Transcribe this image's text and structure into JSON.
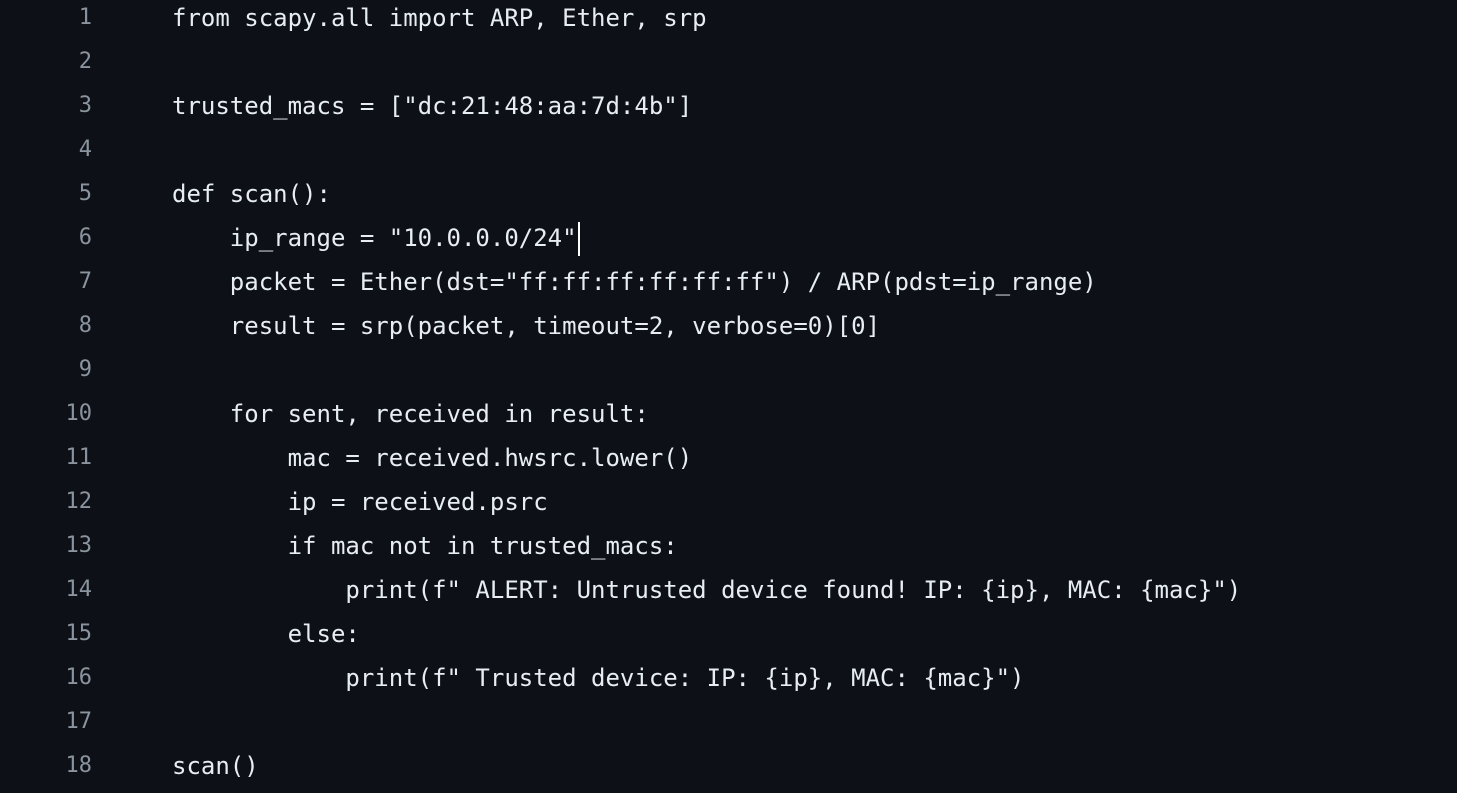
{
  "editor": {
    "lines": [
      {
        "num": "1",
        "code": "from scapy.all import ARP, Ether, srp"
      },
      {
        "num": "2",
        "code": ""
      },
      {
        "num": "3",
        "code": "trusted_macs = [\"dc:21:48:aa:7d:4b\"]"
      },
      {
        "num": "4",
        "code": ""
      },
      {
        "num": "5",
        "code": "def scan():"
      },
      {
        "num": "6",
        "code": "    ip_range = \"10.0.0.0/24\""
      },
      {
        "num": "7",
        "code": "    packet = Ether(dst=\"ff:ff:ff:ff:ff:ff\") / ARP(pdst=ip_range)"
      },
      {
        "num": "8",
        "code": "    result = srp(packet, timeout=2, verbose=0)[0]"
      },
      {
        "num": "9",
        "code": ""
      },
      {
        "num": "10",
        "code": "    for sent, received in result:"
      },
      {
        "num": "11",
        "code": "        mac = received.hwsrc.lower()"
      },
      {
        "num": "12",
        "code": "        ip = received.psrc"
      },
      {
        "num": "13",
        "code": "        if mac not in trusted_macs:"
      },
      {
        "num": "14",
        "code": "            print(f\" ALERT: Untrusted device found! IP: {ip}, MAC: {mac}\")"
      },
      {
        "num": "15",
        "code": "        else:"
      },
      {
        "num": "16",
        "code": "            print(f\" Trusted device: IP: {ip}, MAC: {mac}\")"
      },
      {
        "num": "17",
        "code": ""
      },
      {
        "num": "18",
        "code": "scan()"
      }
    ],
    "cursor_line": 6
  }
}
